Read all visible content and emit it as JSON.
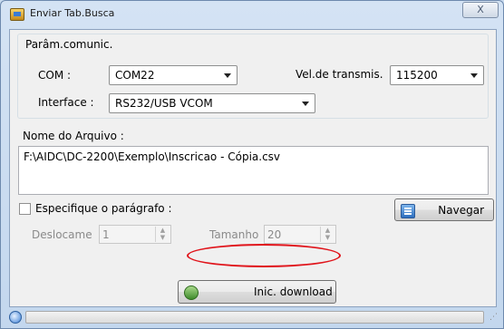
{
  "window": {
    "title": "Enviar Tab.Busca",
    "close_label": "X"
  },
  "comm_group": {
    "legend": "Parâm.comunic.",
    "com_label": "COM :",
    "com_value": "COM22",
    "baud_label": "Vel.de transmis.",
    "baud_value": "115200",
    "interface_label": "Interface :",
    "interface_value": "RS232/USB VCOM"
  },
  "file": {
    "label": "Nome do Arquivo :",
    "path": "F:\\AIDC\\DC-2200\\Exemplo\\Inscricao - Cópia.csv"
  },
  "paragraph": {
    "checkbox_label": "Especifique o parágrafo :",
    "checked": false,
    "offset_label": "Deslocame",
    "offset_value": "1",
    "size_label": "Tamanho",
    "size_value": "20"
  },
  "buttons": {
    "browse": "Navegar",
    "download": "Inic. download"
  },
  "status": {
    "progress": 0
  },
  "icons": {
    "app": "app-icon",
    "browse": "folder-browse-icon",
    "download": "download-icon",
    "status": "globe-icon"
  },
  "colors": {
    "highlight_ellipse": "#e0141b",
    "window_frame": "#c3d7ee"
  }
}
